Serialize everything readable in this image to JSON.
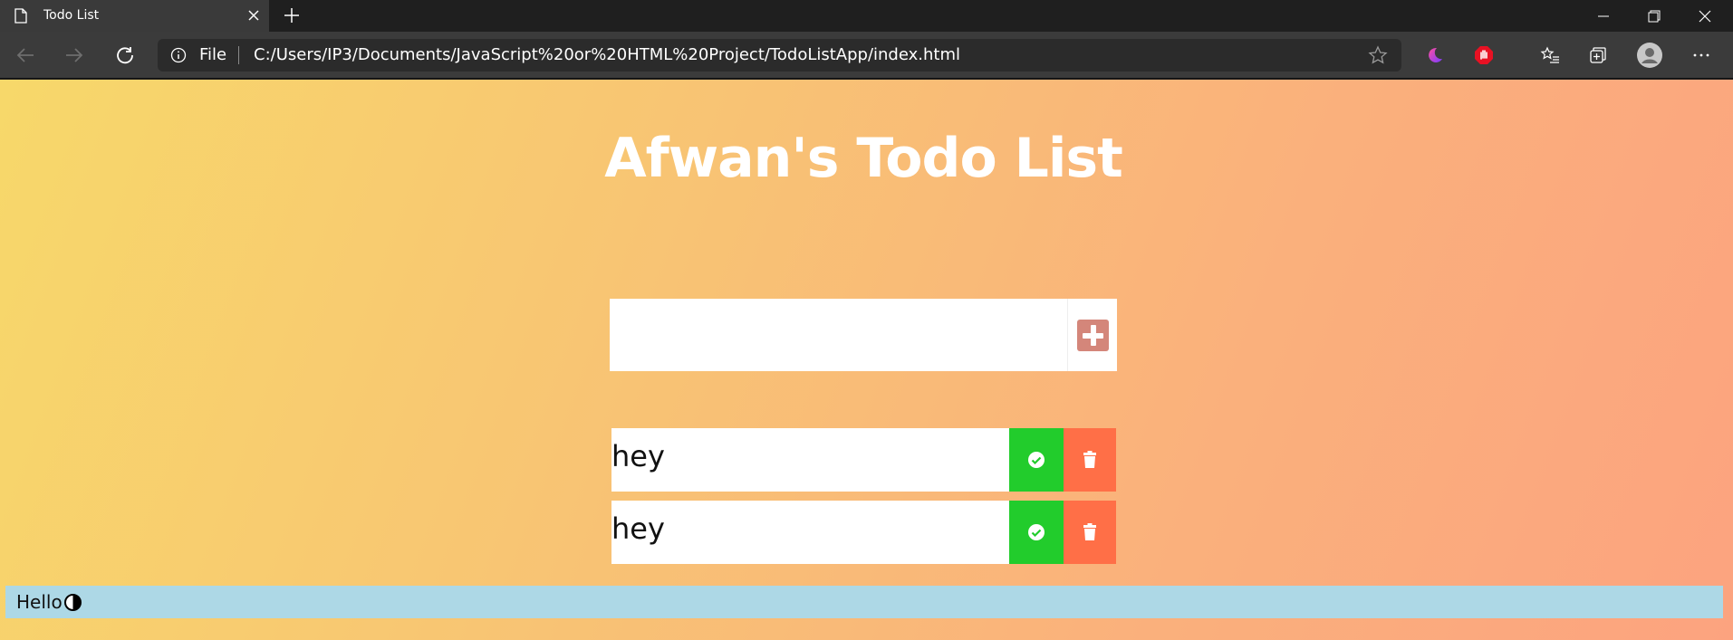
{
  "browser": {
    "tab": {
      "title": "Todo List"
    },
    "address_bar": {
      "scheme": "File",
      "url": "C:/Users/IP3/Documents/JavaScript%20or%20HTML%20Project/TodoListApp/index.html"
    },
    "accent": "#1f1f1f"
  },
  "page": {
    "title": "Afwan's Todo List",
    "input": {
      "value": "",
      "placeholder": ""
    },
    "todos": [
      {
        "text": "hey"
      },
      {
        "text": "hey"
      }
    ],
    "footer": {
      "text": "Hello"
    },
    "colors": {
      "gradient_start": "#f7d86a",
      "gradient_end": "#fca37f",
      "add_icon": "#d4867a",
      "complete": "#22cc2c",
      "trash": "#ff6f47",
      "footer_bg": "#add8e6"
    }
  }
}
